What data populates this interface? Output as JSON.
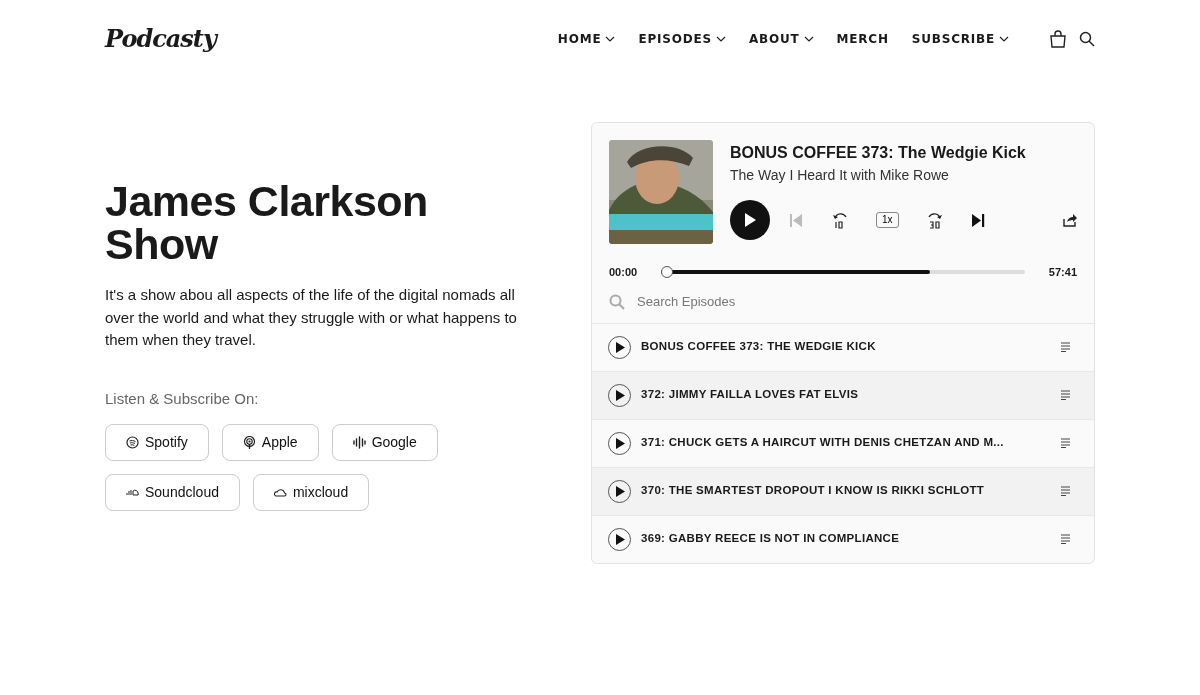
{
  "logo": "Podcasty",
  "nav": [
    {
      "label": "HOME",
      "dropdown": true
    },
    {
      "label": "EPISODES",
      "dropdown": true
    },
    {
      "label": "ABOUT",
      "dropdown": true
    },
    {
      "label": "MERCH",
      "dropdown": false
    },
    {
      "label": "SUBSCRIBE",
      "dropdown": true
    }
  ],
  "hero": {
    "title": "James Clarkson Show",
    "description": "It's a show abou all aspects of the life of the digital nomads all over the world and what they struggle with or what happens to them when they travel.",
    "subscribe_label": "Listen & Subscribe On:",
    "platforms": [
      {
        "label": "Spotify",
        "kind": "spotify"
      },
      {
        "label": "Apple",
        "kind": "apple"
      },
      {
        "label": "Google",
        "kind": "google"
      },
      {
        "label": "Soundcloud",
        "kind": "soundcloud"
      },
      {
        "label": "mixcloud",
        "kind": "mixcloud"
      }
    ]
  },
  "player": {
    "title": "BONUS COFFEE 373: The Wedgie Kick",
    "show": "The Way I Heard It with Mike Rowe",
    "speed": "1x",
    "elapsed": "00:00",
    "duration": "57:41",
    "progress": {
      "level": 0.74
    },
    "search": {
      "placeholder": "Search Episodes"
    },
    "episodes": [
      {
        "title": "BONUS COFFEE 373: THE WEDGIE KICK"
      },
      {
        "title": "372: JIMMY FAILLA LOVES FAT ELVIS"
      },
      {
        "title": "371: CHUCK GETS A HAIRCUT WITH DENIS CHETZAN AND M..."
      },
      {
        "title": "370: THE SMARTEST DROPOUT I KNOW IS RIKKI SCHLOTT"
      },
      {
        "title": "369: GABBY REECE IS NOT IN COMPLIANCE"
      }
    ]
  }
}
